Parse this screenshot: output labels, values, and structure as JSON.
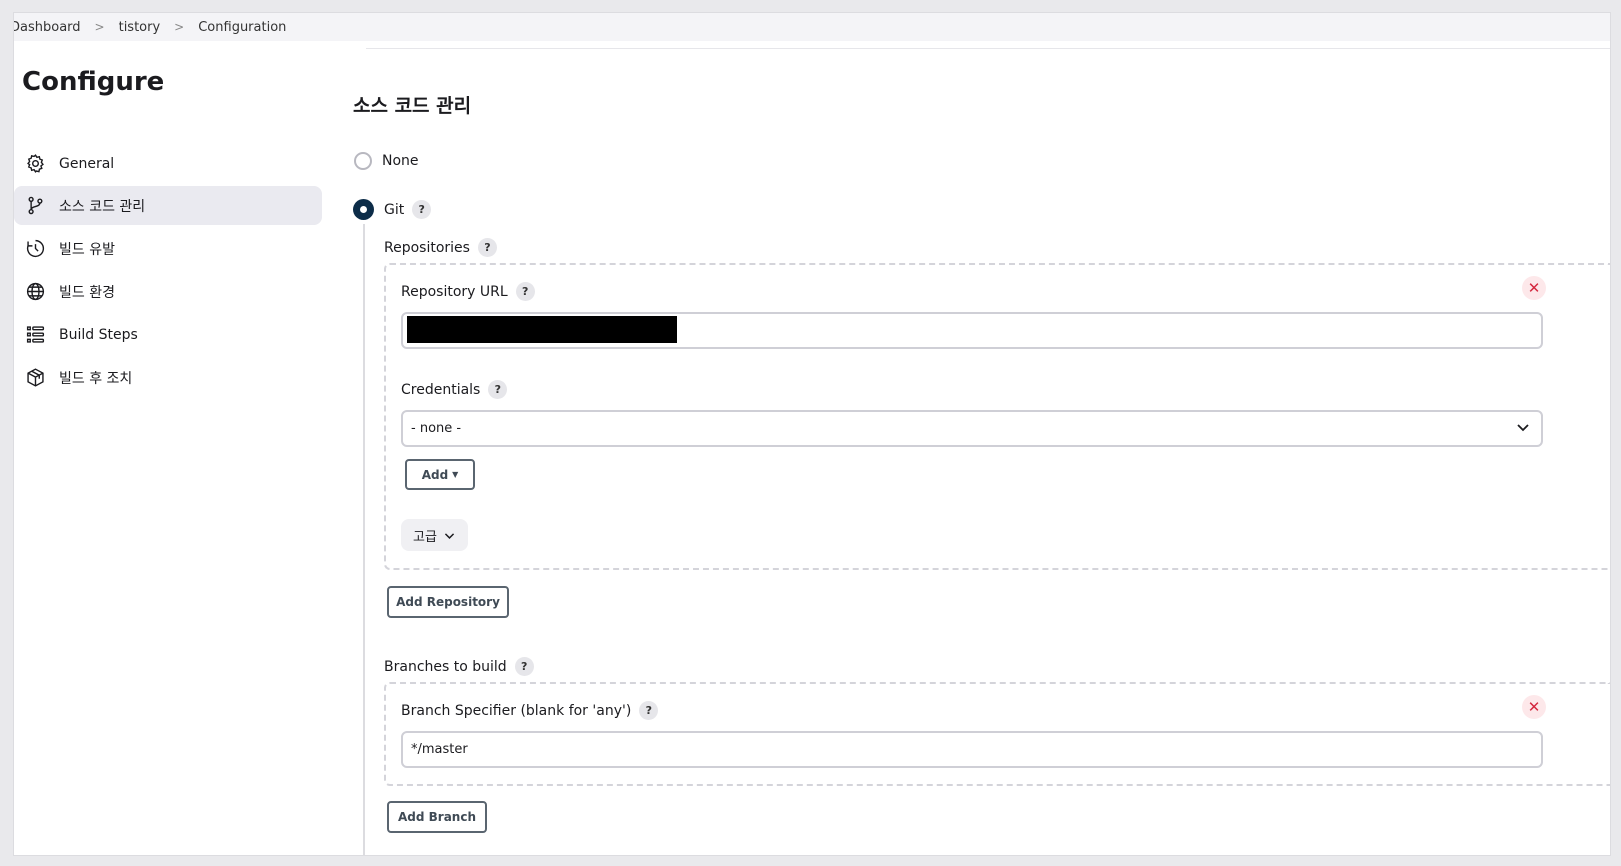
{
  "breadcrumb": [
    "Dashboard",
    "tistory",
    "Configuration"
  ],
  "sidebar": {
    "title": "Configure",
    "items": [
      {
        "label": "General",
        "icon": "gear-icon"
      },
      {
        "label": "소스 코드 관리",
        "icon": "branch-icon",
        "active": true
      },
      {
        "label": "빌드 유발",
        "icon": "clock-icon"
      },
      {
        "label": "빌드 환경",
        "icon": "globe-icon"
      },
      {
        "label": "Build Steps",
        "icon": "list-icon"
      },
      {
        "label": "빌드 후 조치",
        "icon": "package-icon"
      }
    ]
  },
  "main": {
    "section_title": "소스 코드 관리",
    "radio_none": "None",
    "radio_git": "Git",
    "help_glyph": "?",
    "repositories_label": "Repositories",
    "repo_url_label": "Repository URL",
    "credentials_label": "Credentials",
    "credentials_value": "- none -",
    "add_label": "Add",
    "advanced_label": "고급",
    "add_repository_label": "Add Repository",
    "branches_label": "Branches to build",
    "branch_spec_label": "Branch Specifier (blank for 'any')",
    "branch_spec_value": "*/master",
    "add_branch_label": "Add Branch",
    "close_glyph": "✕"
  },
  "colors": {
    "accent_radio": "#0c2c48",
    "close_red": "#d4283f",
    "active_item_bg": "#eaeaf0"
  }
}
